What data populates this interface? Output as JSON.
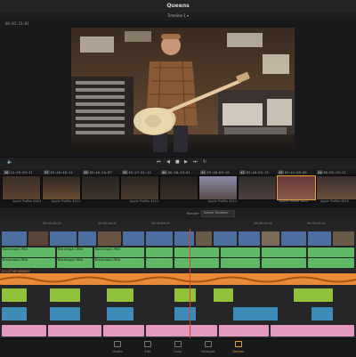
{
  "app": {
    "title": "Queens"
  },
  "viewer": {
    "timeline_name": "Timeline 1",
    "timecode": "00:03:23:01"
  },
  "strip_timecodes": [
    {
      "n": "36",
      "tc": "12:49:59:21"
    },
    {
      "n": "37",
      "tc": "03:40:40:14"
    },
    {
      "n": "38",
      "tc": "03:46:20:07"
    },
    {
      "n": "39",
      "tc": "03:27:01:12"
    },
    {
      "n": "40",
      "tc": "08:38:19:01"
    },
    {
      "n": "41",
      "tc": "03:46:09:18"
    },
    {
      "n": "42",
      "tc": "03:48:03:13"
    },
    {
      "n": "43",
      "tc": "03:44:09:09"
    },
    {
      "n": "44",
      "tc": "05:05:29:11"
    }
  ],
  "thumb_labels": [
    "Apple ProRes 4444",
    "Apple ProRes 4444",
    "Apple ProRes 4444",
    "Apple ProRes 4444",
    "Apple ProRes 4444",
    "Apple ProRes 4444"
  ],
  "timeline": {
    "render_label": "Render",
    "select_label": "Select Timeline",
    "track_name_label": "V1 LUT ME MARKER",
    "audio_clip_label": "Blackmagic URSA",
    "ruler_marks": [
      "00:05:24:00",
      "00:06:16:00",
      "00:08:09:00",
      "00:08:10:00",
      "00:09:12:00"
    ]
  },
  "pages": [
    {
      "id": "media",
      "label": "Media",
      "active": false
    },
    {
      "id": "edit",
      "label": "Edit",
      "active": false
    },
    {
      "id": "color",
      "label": "Color",
      "active": false
    },
    {
      "id": "fairlight",
      "label": "Fairlight",
      "active": false
    },
    {
      "id": "deliver",
      "label": "Deliver",
      "active": true
    }
  ],
  "colors": {
    "accent": "#e3a03a",
    "video_clip": "#4d6fa0",
    "audio_green": "#5fb866",
    "audio_orange": "#e88a3a",
    "audio_lime": "#8fc23a",
    "audio_blue": "#3f8bb8",
    "audio_pink": "#e39ac0"
  }
}
